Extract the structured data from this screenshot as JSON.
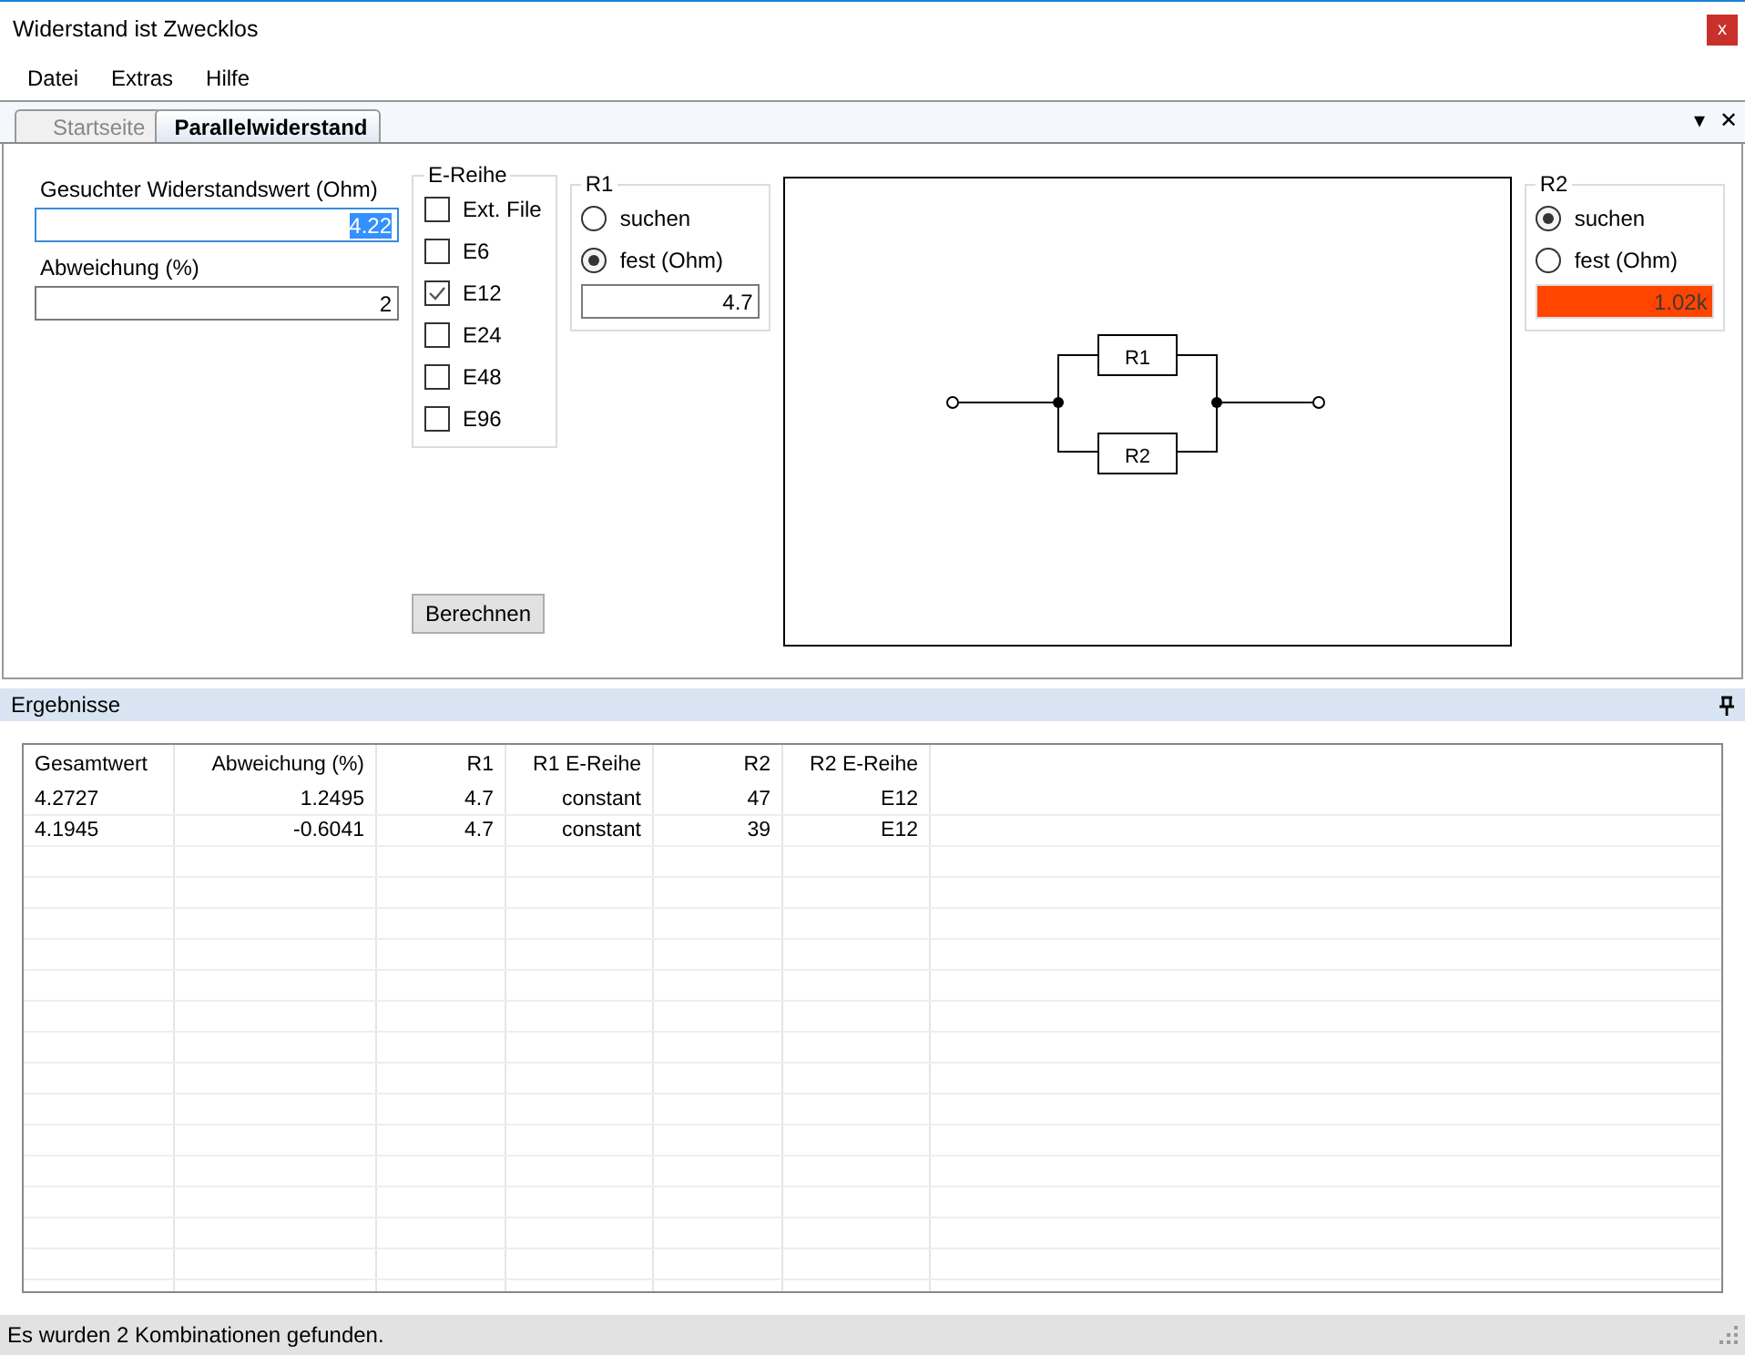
{
  "window": {
    "title": "Widerstand ist Zwecklos",
    "close": "x"
  },
  "menu": [
    "Datei",
    "Extras",
    "Hilfe"
  ],
  "tabs": [
    {
      "label": "Startseite",
      "selected": false
    },
    {
      "label": "Parallelwiderstand",
      "selected": true
    }
  ],
  "tab_strip_icons": {
    "dropdown": "▾",
    "close": "✕"
  },
  "form": {
    "target_label": "Gesuchter Widerstandswert (Ohm)",
    "target_value": "4.22",
    "tolerance_label": "Abweichung (%)",
    "tolerance_value": "2"
  },
  "e_series": {
    "title": "E-Reihe",
    "items": [
      {
        "label": "Ext. File",
        "checked": false
      },
      {
        "label": "E6",
        "checked": false
      },
      {
        "label": "E12",
        "checked": true
      },
      {
        "label": "E24",
        "checked": false
      },
      {
        "label": "E48",
        "checked": false
      },
      {
        "label": "E96",
        "checked": false
      }
    ]
  },
  "r_groups": [
    {
      "title": "R1",
      "options": [
        {
          "label": "suchen",
          "selected": false
        },
        {
          "label": "fest (Ohm)",
          "selected": true
        }
      ],
      "value": "4.7",
      "invalid": false
    },
    {
      "title": "R2",
      "options": [
        {
          "label": "suchen",
          "selected": true
        },
        {
          "label": "fest (Ohm)",
          "selected": false
        }
      ],
      "value": "1.02k",
      "invalid": true
    }
  ],
  "calculate_button": "Berechnen",
  "diagram": {
    "labels": [
      "R1",
      "R2"
    ]
  },
  "results": {
    "title": "Ergebnisse",
    "columns": [
      "Gesamtwert",
      "Abweichung (%)",
      "R1",
      "R1 E-Reihe",
      "R2",
      "R2 E-Reihe"
    ],
    "rows": [
      [
        "4.2727",
        "1.2495",
        "4.7",
        "constant",
        "47",
        "E12"
      ],
      [
        "4.1945",
        "-0.6041",
        "4.7",
        "constant",
        "39",
        "E12"
      ]
    ]
  },
  "status_bar": "Es wurden 2 Kombinationen gefunden."
}
